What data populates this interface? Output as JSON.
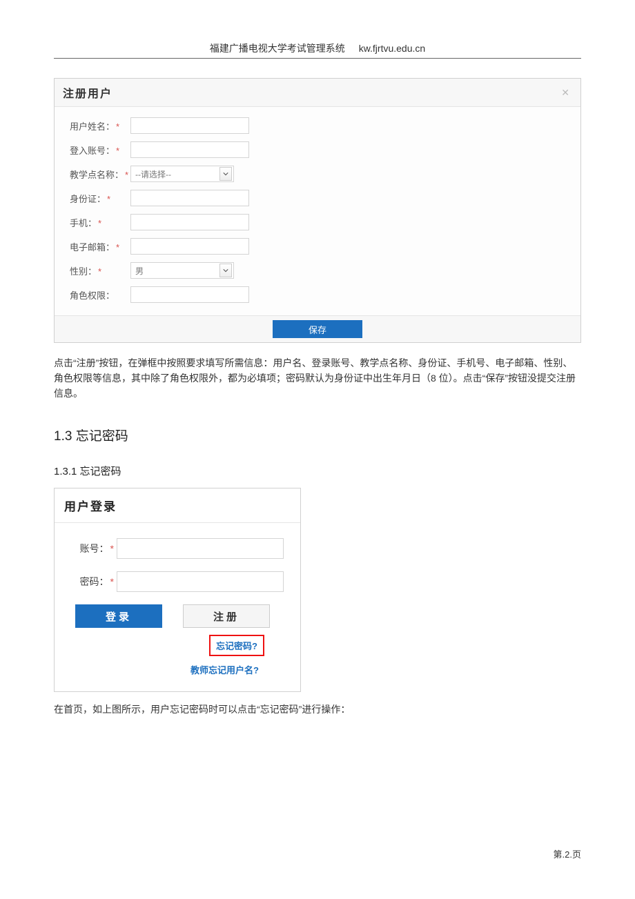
{
  "header": {
    "title": "福建广播电视大学考试管理系统",
    "url": "kw.fjrtvu.edu.cn"
  },
  "modal": {
    "title": "注册用户",
    "close": "✕",
    "fields": {
      "username": {
        "label": "用户姓名：",
        "required": "*"
      },
      "account": {
        "label": "登入账号：",
        "required": "*"
      },
      "school": {
        "label": "教学点名称：",
        "required": "*",
        "placeholder": "--请选择--"
      },
      "idcard": {
        "label": "身份证：",
        "required": "*"
      },
      "phone": {
        "label": "手机：",
        "required": "*"
      },
      "email": {
        "label": "电子邮箱：",
        "required": "*"
      },
      "gender": {
        "label": "性别：",
        "required": "*",
        "value": "男"
      },
      "role": {
        "label": "角色权限："
      }
    },
    "save": "保存"
  },
  "para1": "点击“注册”按钮，在弹框中按照要求填写所需信息：用户名、登录账号、教学点名称、身份证、手机号、电子邮箱、性别、角色权限等信息，其中除了角色权限外，都为必填项；密码默认为身份证中出生年月日（8 位）。点击“保存”按钮没提交注册信息。",
  "sec13": "1.3 忘记密码",
  "sec131": "1.3.1 忘记密码",
  "login": {
    "title": "用户登录",
    "account": {
      "label": "账号：",
      "required": "*"
    },
    "password": {
      "label": "密码：",
      "required": "*"
    },
    "btn_login": "登录",
    "btn_register": "注册",
    "link_forgot": "忘记密码?",
    "link_teacher": "教师忘记用户名?"
  },
  "para2": "在首页，如上图所示，用户忘记密码时可以点击“忘记密码”进行操作：",
  "footer": "第.2.页"
}
